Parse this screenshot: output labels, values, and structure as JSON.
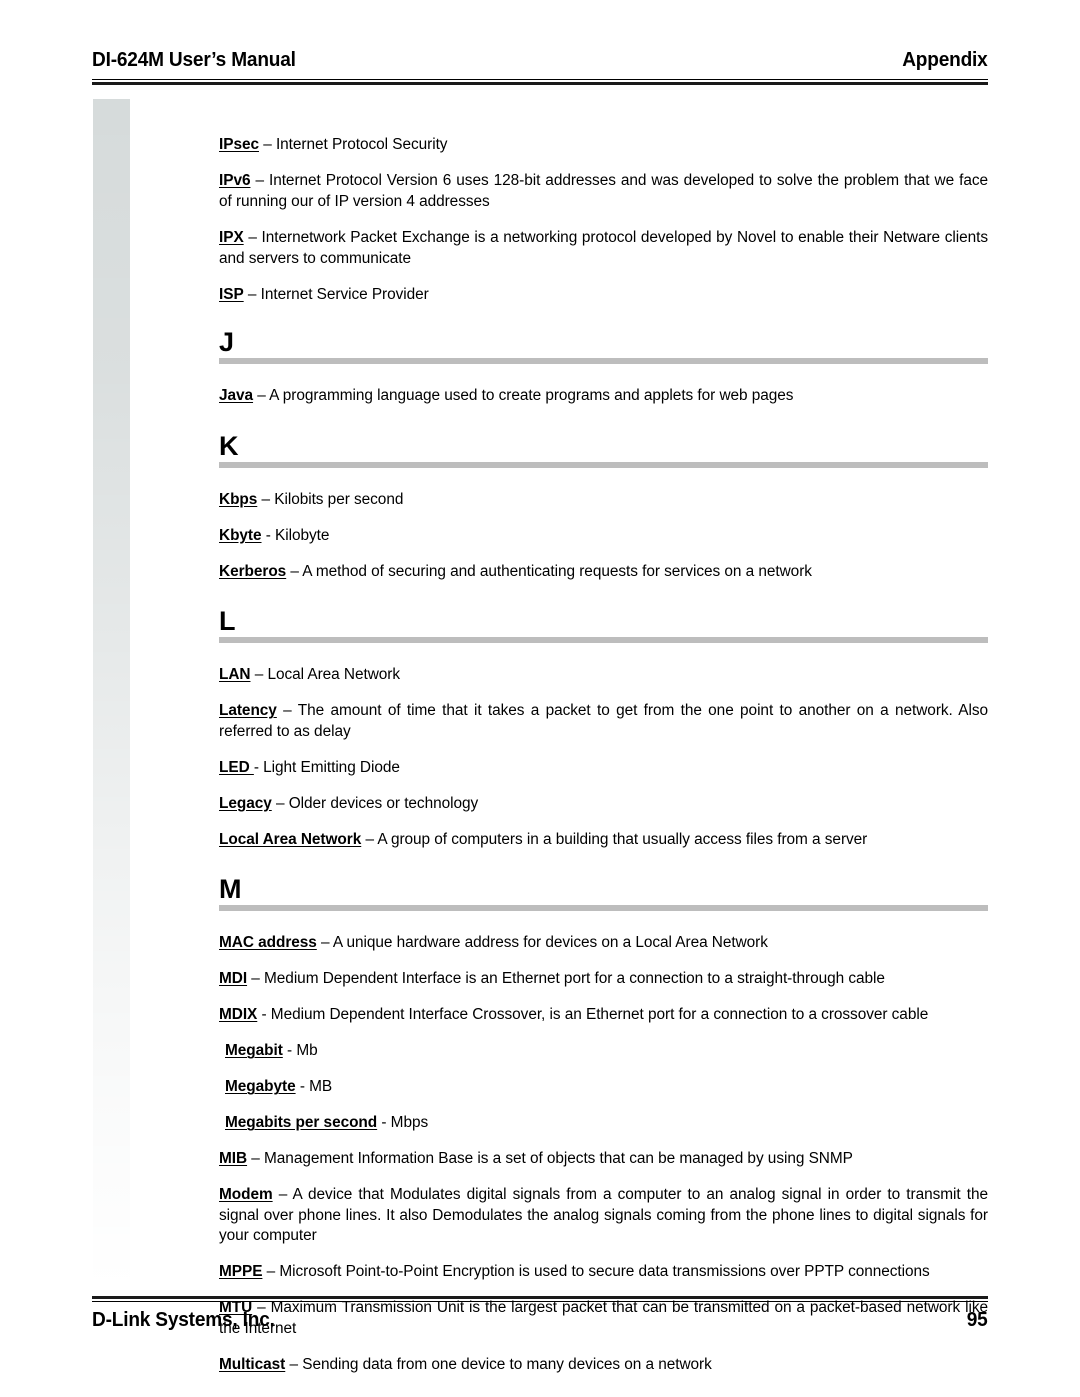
{
  "header": {
    "left_title": "DI-624M User’s Manual",
    "right_title": "Appendix"
  },
  "footer": {
    "company": "D-Link Systems, Inc.",
    "page_number": "95"
  },
  "decoration": {
    "square_color": "#d6dbdb",
    "columns": 2,
    "rows": 26
  },
  "section_rule_color": "#bdbdbd",
  "glossary": {
    "entries_before_j": [
      {
        "term": "IPsec",
        "definition": " – Internet Protocol Security"
      },
      {
        "term": "IPv6",
        "definition": " – Internet Protocol Version 6 uses 128-bit addresses and was developed to solve the problem that we face of running our of IP version 4 addresses"
      },
      {
        "term": "IPX",
        "definition": " – Internetwork Packet Exchange is a networking protocol developed by Novel to enable their Netware clients and servers to communicate"
      },
      {
        "term": "ISP",
        "definition": " – Internet Service Provider"
      }
    ],
    "sections": [
      {
        "letter": "J",
        "entries": [
          {
            "term": "Java",
            "definition": " – A programming language used to create programs and applets for web pages"
          }
        ]
      },
      {
        "letter": "K",
        "entries": [
          {
            "term": "Kbps",
            "definition": " – Kilobits per second"
          },
          {
            "term": "Kbyte",
            "definition": " - Kilobyte"
          },
          {
            "term": "Kerberos",
            "definition": " – A method of securing and authenticating requests for services on a network"
          }
        ]
      },
      {
        "letter": "L",
        "entries": [
          {
            "term": "LAN",
            "definition": " – Local Area Network"
          },
          {
            "term": "Latency",
            "definition": " – The amount of time that it takes a packet to get from the one point to another on a network.  Also referred to as delay"
          },
          {
            "term": "LED ",
            "definition": " - Light Emitting Diode"
          },
          {
            "term": "Legacy",
            "definition": " – Older devices or technology"
          },
          {
            "term": "Local Area Network",
            "definition": " – A group of computers in a building that usually access files from a server"
          }
        ]
      },
      {
        "letter": "M",
        "entries": [
          {
            "term": "MAC address",
            "definition": " – A unique hardware address for devices on a Local Area Network"
          },
          {
            "term": "MDI",
            "definition": " – Medium Dependent Interface is an Ethernet port for a connection to a straight-through cable"
          },
          {
            "term": "MDIX",
            "definition": " - Medium Dependent Interface Crossover, is an Ethernet port for a connection to a crossover cable"
          },
          {
            "term": "Megabit",
            "definition": " - Mb",
            "indented": true
          },
          {
            "term": "Megabyte",
            "definition": " - MB",
            "indented": true
          },
          {
            "term": "Megabits per second",
            "definition": " - Mbps",
            "indented": true
          },
          {
            "term": "MIB",
            "definition": " – Management Information Base is a set of objects that can be managed by using SNMP"
          },
          {
            "term": "Modem",
            "definition": " – A device that Modulates digital signals from a computer to an analog signal in order to transmit the signal over phone lines.  It also Demodulates the analog signals coming from the phone lines to digital signals for your computer"
          },
          {
            "term": "MPPE",
            "definition": " – Microsoft Point-to-Point Encryption is used to secure data transmissions over PPTP connections"
          },
          {
            "term": "MTU",
            "definition": " – Maximum Transmission Unit is the largest packet that can be transmitted on a packet-based network like the Internet"
          },
          {
            "term": "Multicast",
            "definition": " – Sending data from one device to many devices on a network"
          }
        ]
      }
    ]
  }
}
